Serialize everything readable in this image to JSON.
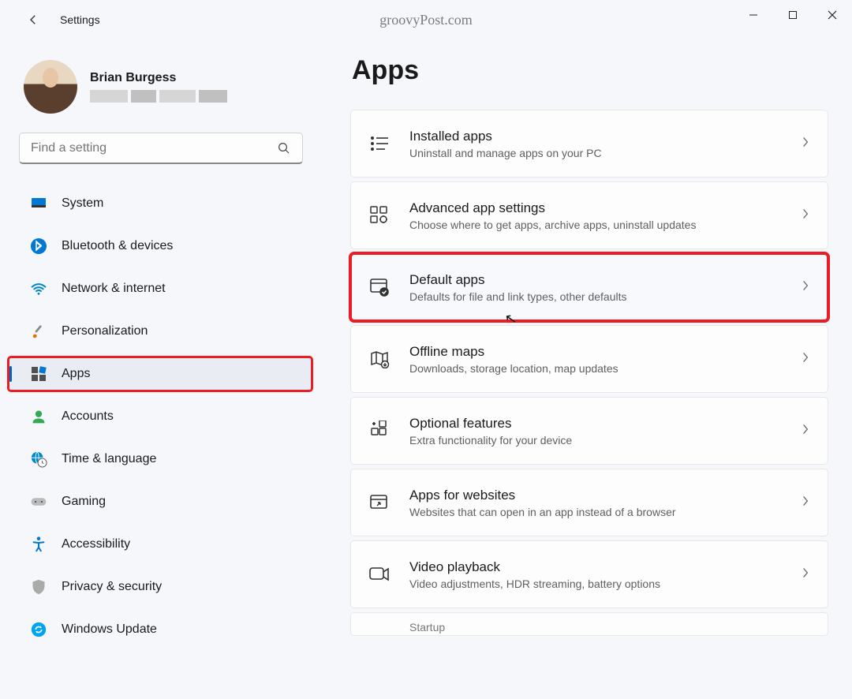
{
  "header": {
    "window_title": "Settings",
    "watermark": "groovyPost.com"
  },
  "user": {
    "name": "Brian Burgess"
  },
  "search": {
    "placeholder": "Find a setting"
  },
  "sidebar": {
    "items": [
      {
        "label": "System",
        "icon": "system"
      },
      {
        "label": "Bluetooth & devices",
        "icon": "bluetooth"
      },
      {
        "label": "Network & internet",
        "icon": "wifi"
      },
      {
        "label": "Personalization",
        "icon": "brush"
      },
      {
        "label": "Apps",
        "icon": "apps"
      },
      {
        "label": "Accounts",
        "icon": "person"
      },
      {
        "label": "Time & language",
        "icon": "globe-clock"
      },
      {
        "label": "Gaming",
        "icon": "gamepad"
      },
      {
        "label": "Accessibility",
        "icon": "accessibility"
      },
      {
        "label": "Privacy & security",
        "icon": "shield"
      },
      {
        "label": "Windows Update",
        "icon": "update"
      }
    ],
    "selected_index": 4,
    "highlighted_index": 4
  },
  "page": {
    "title": "Apps",
    "cards": [
      {
        "title": "Installed apps",
        "sub": "Uninstall and manage apps on your PC",
        "icon": "list"
      },
      {
        "title": "Advanced app settings",
        "sub": "Choose where to get apps, archive apps, uninstall updates",
        "icon": "grid-gear"
      },
      {
        "title": "Default apps",
        "sub": "Defaults for file and link types, other defaults",
        "icon": "window-check"
      },
      {
        "title": "Offline maps",
        "sub": "Downloads, storage location, map updates",
        "icon": "map"
      },
      {
        "title": "Optional features",
        "sub": "Extra functionality for your device",
        "icon": "puzzle-plus"
      },
      {
        "title": "Apps for websites",
        "sub": "Websites that can open in an app instead of a browser",
        "icon": "window-link"
      },
      {
        "title": "Video playback",
        "sub": "Video adjustments, HDR streaming, battery options",
        "icon": "video"
      },
      {
        "title": "Startup",
        "sub": "",
        "icon": "startup"
      }
    ],
    "highlighted_card_index": 2
  },
  "colors": {
    "highlight_red": "#eb1c24",
    "accent_blue": "#0067c0"
  }
}
